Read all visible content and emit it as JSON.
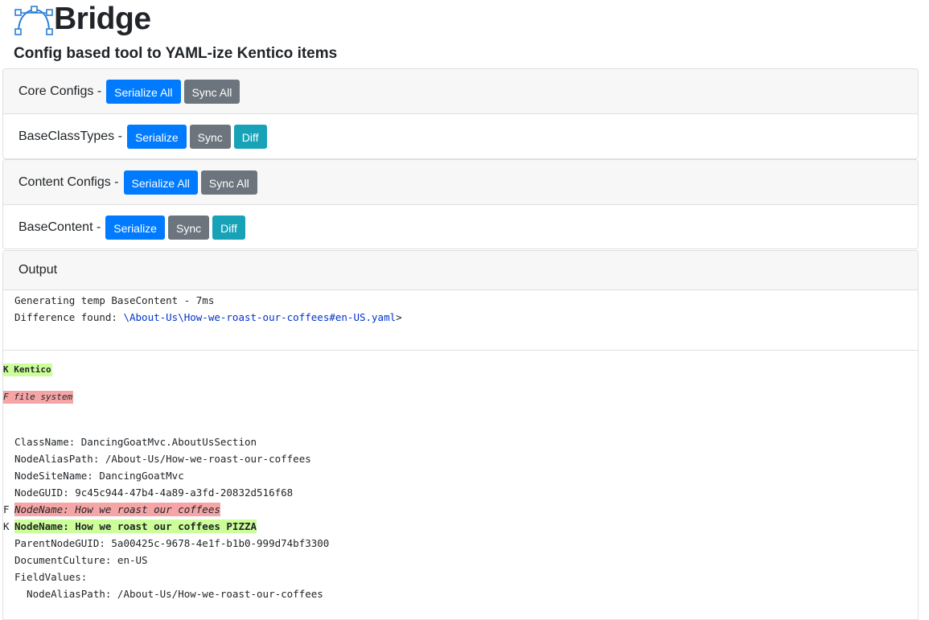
{
  "app": {
    "title": "Bridge",
    "subtitle": "Config based tool to YAML-ize Kentico items"
  },
  "core_configs": {
    "label": "Core Configs -",
    "serialize_all": "Serialize All",
    "sync_all": "Sync All",
    "items": [
      {
        "label": "BaseClassTypes -",
        "serialize": "Serialize",
        "sync": "Sync",
        "diff": "Diff"
      }
    ]
  },
  "content_configs": {
    "label": "Content Configs -",
    "serialize_all": "Serialize All",
    "sync_all": "Sync All",
    "items": [
      {
        "label": "BaseContent -",
        "serialize": "Serialize",
        "sync": "Sync",
        "diff": "Diff"
      }
    ]
  },
  "output": {
    "header": "Output",
    "log_lines": [
      "Generating temp BaseContent - 7ms"
    ],
    "difference_prefix": "Difference found: ",
    "difference_path": "\\About-Us\\How-we-roast-our-coffees#en-US.yaml",
    "difference_suffix": ">",
    "legend_kentico": "K Kentico",
    "legend_filesystem": "F file system",
    "yaml_lines": [
      {
        "marker": "",
        "text": "ClassName: DancingGoatMvc.AboutUsSection",
        "state": "same"
      },
      {
        "marker": "",
        "text": "NodeAliasPath: /About-Us/How-we-roast-our-coffees",
        "state": "same"
      },
      {
        "marker": "",
        "text": "NodeSiteName: DancingGoatMvc",
        "state": "same"
      },
      {
        "marker": "",
        "text": "NodeGUID: 9c45c944-47b4-4a89-a3fd-20832d516f68",
        "state": "same"
      },
      {
        "marker": "F",
        "text": "NodeName: How we roast our coffees",
        "state": "removed"
      },
      {
        "marker": "K",
        "text": "NodeName: How we roast our coffees PIZZA",
        "state": "added"
      },
      {
        "marker": "",
        "text": "ParentNodeGUID: 5a00425c-9678-4e1f-b1b0-999d74bf3300",
        "state": "same"
      },
      {
        "marker": "",
        "text": "DocumentCulture: en-US",
        "state": "same"
      },
      {
        "marker": "",
        "text": "FieldValues:",
        "state": "same"
      },
      {
        "marker": "",
        "text": "  NodeAliasPath: /About-Us/How-we-roast-our-coffees",
        "state": "same"
      }
    ]
  },
  "colors": {
    "primary": "#007bff",
    "secondary": "#6c757d",
    "info": "#17a2b8",
    "added_bg": "#ccff99",
    "removed_bg": "#f5a5a5",
    "link": "#0033cc"
  }
}
